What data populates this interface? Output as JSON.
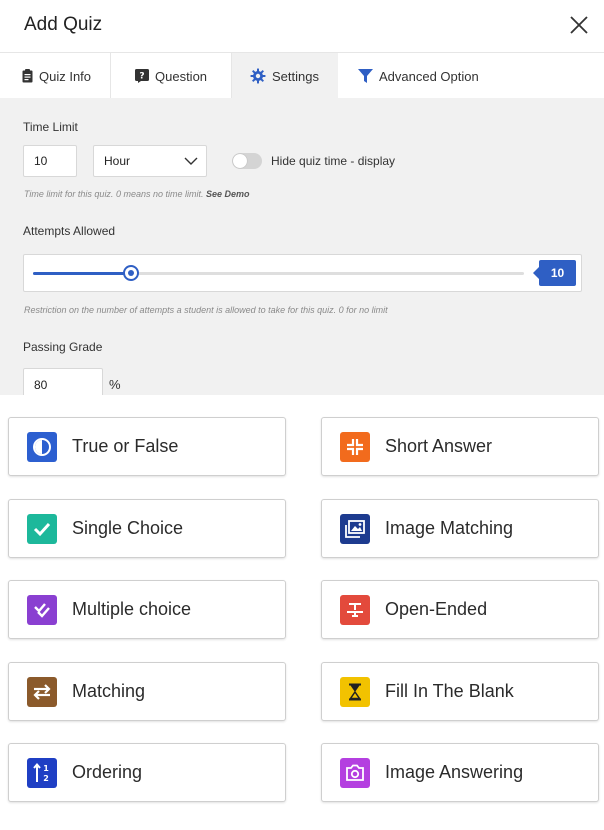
{
  "header": {
    "title": "Add Quiz"
  },
  "tabs": [
    {
      "label": "Quiz Info",
      "icon": "clipboard-icon"
    },
    {
      "label": "Question",
      "icon": "question-icon"
    },
    {
      "label": "Settings",
      "icon": "gear-icon",
      "active": true
    },
    {
      "label": "Advanced Option",
      "icon": "filter-icon"
    }
  ],
  "settings": {
    "time_limit": {
      "label": "Time Limit",
      "value": "10",
      "unit": "Hour",
      "toggle_label": "Hide quiz time - display",
      "toggle_on": false,
      "help": "Time limit for this quiz. 0 means no time limit.",
      "help_link": "See Demo"
    },
    "attempts": {
      "label": "Attempts Allowed",
      "value": "10",
      "fraction": 0.2,
      "help": "Restriction on the number of attempts a student is allowed to take for this quiz. 0 for no limit"
    },
    "passing_grade": {
      "label": "Passing Grade",
      "value": "80",
      "unit": "%"
    }
  },
  "question_types": [
    {
      "label": "True or False",
      "icon": "half-circle-icon",
      "color": "#2c5fd0"
    },
    {
      "label": "Short Answer",
      "icon": "compress-icon",
      "color": "#f26b1d"
    },
    {
      "label": "Single Choice",
      "icon": "check-icon",
      "color": "#1db89b"
    },
    {
      "label": "Image Matching",
      "icon": "image-icon",
      "color": "#1d3b8f"
    },
    {
      "label": "Multiple choice",
      "icon": "double-check-icon",
      "color": "#8a3fd1"
    },
    {
      "label": "Open-Ended",
      "icon": "text-icon",
      "color": "#e34a3c"
    },
    {
      "label": "Matching",
      "icon": "swap-icon",
      "color": "#8b5a2b"
    },
    {
      "label": "Fill In The Blank",
      "icon": "hourglass-icon",
      "color": "#f2c200"
    },
    {
      "label": "Ordering",
      "icon": "sort-icon",
      "color": "#1f3fc4"
    },
    {
      "label": "Image Answering",
      "icon": "camera-icon",
      "color": "#b43fe0"
    }
  ]
}
